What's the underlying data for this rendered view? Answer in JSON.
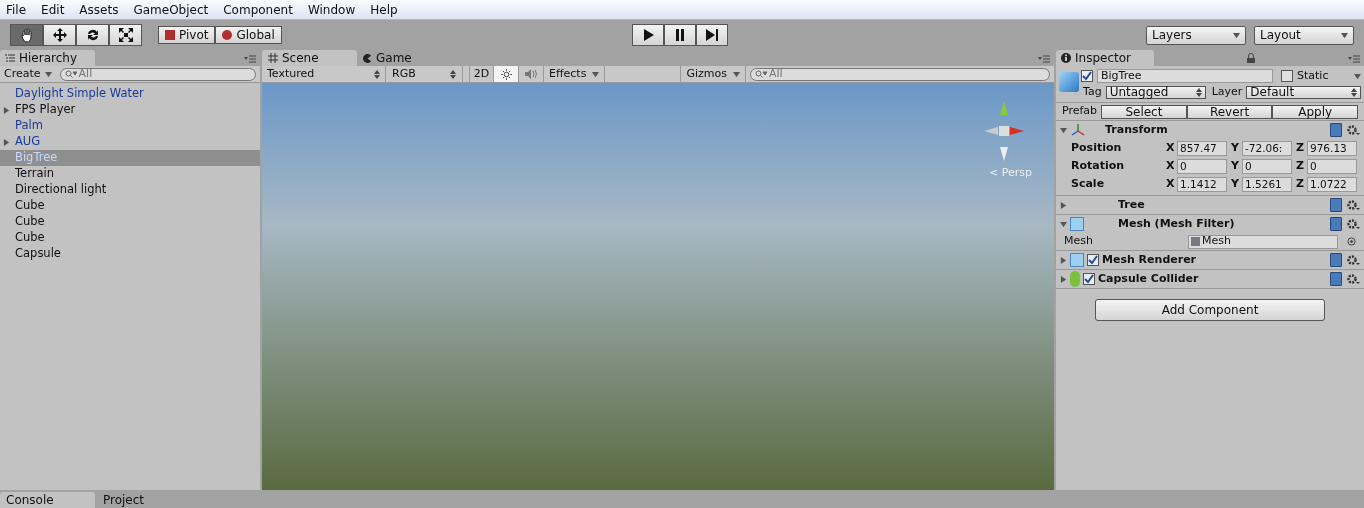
{
  "menu": [
    "File",
    "Edit",
    "Assets",
    "GameObject",
    "Component",
    "Window",
    "Help"
  ],
  "tools": [
    {
      "kind": "hand",
      "selected": true
    },
    {
      "kind": "move",
      "selected": false
    },
    {
      "kind": "rotate",
      "selected": false
    },
    {
      "kind": "scale",
      "selected": false
    }
  ],
  "pivot": [
    "Pivot",
    "Global"
  ],
  "play": [
    {
      "kind": "play",
      "selected": false
    },
    {
      "kind": "pause",
      "selected": false
    },
    {
      "kind": "step",
      "selected": false
    }
  ],
  "layers": "Layers",
  "layout": "Layout",
  "hierarchy": {
    "tab": "Hierarchy",
    "create": "Create",
    "search": "All",
    "items": [
      {
        "label": "Daylight Simple Water",
        "prefab": true,
        "expandable": false,
        "selected": false
      },
      {
        "label": "FPS Player",
        "prefab": false,
        "expandable": true,
        "selected": false
      },
      {
        "label": "Palm",
        "prefab": true,
        "expandable": false,
        "selected": false
      },
      {
        "label": "AUG",
        "prefab": true,
        "expandable": true,
        "selected": false
      },
      {
        "label": "BigTree",
        "prefab": true,
        "expandable": false,
        "selected": true
      },
      {
        "label": "Terrain",
        "prefab": false,
        "expandable": false,
        "selected": false
      },
      {
        "label": "Directional light",
        "prefab": false,
        "expandable": false,
        "selected": false
      },
      {
        "label": "Cube",
        "prefab": false,
        "expandable": false,
        "selected": false
      },
      {
        "label": "Cube",
        "prefab": false,
        "expandable": false,
        "selected": false
      },
      {
        "label": "Cube",
        "prefab": false,
        "expandable": false,
        "selected": false
      },
      {
        "label": "Capsule",
        "prefab": false,
        "expandable": false,
        "selected": false
      }
    ]
  },
  "scene": {
    "tabs": [
      {
        "label": "Scene",
        "selected": true
      },
      {
        "label": "Game",
        "selected": false
      }
    ],
    "shading": "Textured",
    "mode": "RGB",
    "two_d": "2D",
    "effects": "Effects",
    "gizmos": "Gizmos",
    "search": "All",
    "lighting_on": true,
    "audio_on": false,
    "persp": "< Persp"
  },
  "inspector": {
    "tab": "Inspector",
    "active": true,
    "name": "BigTree",
    "static_label": "Static",
    "static": false,
    "tag_label": "Tag",
    "tag": "Untagged",
    "layer_label": "Layer",
    "layer": "Default",
    "prefab_label": "Prefab",
    "prefab_buttons": [
      "Select",
      "Revert",
      "Apply"
    ],
    "transform": {
      "title": "Transform",
      "expanded": true,
      "rows": [
        {
          "label": "Position",
          "axes": [
            {
              "label": "X",
              "value": "857.47"
            },
            {
              "label": "Y",
              "value": "-72.06:"
            },
            {
              "label": "Z",
              "value": "976.13"
            }
          ]
        },
        {
          "label": "Rotation",
          "axes": [
            {
              "label": "X",
              "value": "0"
            },
            {
              "label": "Y",
              "value": "0"
            },
            {
              "label": "Z",
              "value": "0"
            }
          ]
        },
        {
          "label": "Scale",
          "axes": [
            {
              "label": "X",
              "value": "1.1412"
            },
            {
              "label": "Y",
              "value": "1.5261"
            },
            {
              "label": "Z",
              "value": "1.0722"
            }
          ]
        }
      ]
    },
    "components": [
      {
        "kind": "tree",
        "title": "Tree",
        "expanded": false
      },
      {
        "kind": "mesh_filter",
        "title": "Mesh (Mesh Filter)",
        "expanded": true,
        "field_label": "Mesh",
        "field_value": "Mesh"
      },
      {
        "kind": "mesh_renderer",
        "title": "Mesh Renderer",
        "expanded": false,
        "enabled": true
      },
      {
        "kind": "capsule",
        "title": "Capsule Collider",
        "expanded": false,
        "enabled": true
      }
    ],
    "add": "Add Component"
  },
  "bottom_tabs": [
    {
      "label": "Console",
      "selected": true
    },
    {
      "label": "Project",
      "selected": false
    }
  ]
}
